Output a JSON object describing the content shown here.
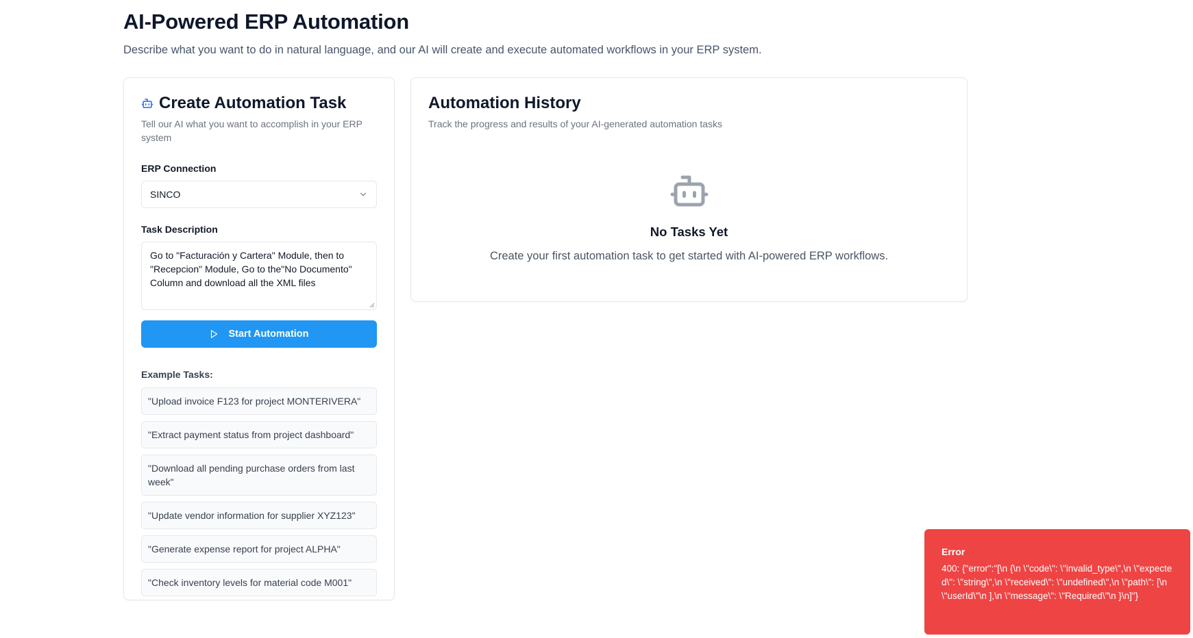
{
  "header": {
    "title": "AI-Powered ERP Automation",
    "subtitle": "Describe what you want to do in natural language, and our AI will create and execute automated workflows in your ERP system."
  },
  "create_task": {
    "icon": "bot-icon",
    "title": "Create Automation Task",
    "description": "Tell our AI what you want to accomplish in your ERP system",
    "erp_label": "ERP Connection",
    "erp_selected": "SINCO",
    "task_label": "Task Description",
    "task_value": "Go to \"Facturación y Cartera\" Module, then to \"Recepcion\" Module, Go to the\"No Documento\" Column and download all the XML files",
    "start_button": "Start Automation",
    "examples_title": "Example Tasks:",
    "examples": [
      "\"Upload invoice F123 for project MONTERIVERA\"",
      "\"Extract payment status from project dashboard\"",
      "\"Download all pending purchase orders from last week\"",
      "\"Update vendor information for supplier XYZ123\"",
      "\"Generate expense report for project ALPHA\"",
      "\"Check inventory levels for material code M001\""
    ]
  },
  "history": {
    "title": "Automation History",
    "description": "Track the progress and results of your AI-generated automation tasks",
    "empty_title": "No Tasks Yet",
    "empty_description": "Create your first automation task to get started with AI-powered ERP workflows."
  },
  "toast": {
    "title": "Error",
    "message": "400: {\"error\":\"[\\n {\\n \\\"code\\\": \\\"invalid_type\\\",\\n \\\"expected\\\": \\\"string\\\",\\n \\\"received\\\": \\\"undefined\\\",\\n \\\"path\\\": [\\n \\\"userId\\\"\\n ],\\n \\\"message\\\": \\\"Required\\\"\\n }\\n]\"}",
    "color": "#ef4444"
  },
  "colors": {
    "primary": "#2196f3",
    "bot_icon_blue": "#2563eb",
    "empty_icon_gray": "#9ca3af"
  }
}
